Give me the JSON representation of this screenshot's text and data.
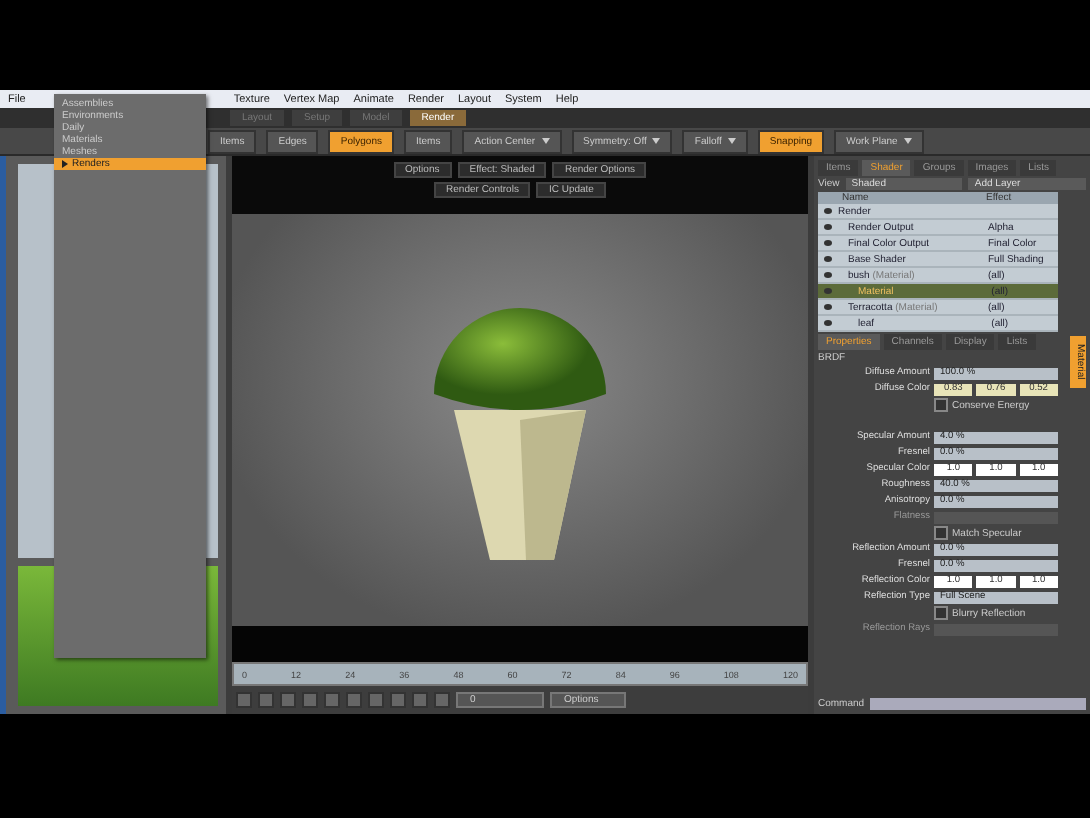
{
  "menu_bar": {
    "lead": [
      "File"
    ],
    "items": [
      "Texture",
      "Vertex Map",
      "Animate",
      "Render",
      "Layout",
      "System",
      "Help"
    ]
  },
  "dropdown": {
    "items": [
      {
        "label": "Assemblies",
        "selected": false
      },
      {
        "label": "Environments",
        "selected": false
      },
      {
        "label": "Daily",
        "selected": false
      },
      {
        "label": "Materials",
        "selected": false
      },
      {
        "label": "Meshes",
        "selected": false
      },
      {
        "label": "Renders",
        "selected": true
      }
    ]
  },
  "mode_tabs": [
    {
      "label": "Layout",
      "selected": false
    },
    {
      "label": "Setup",
      "selected": false
    },
    {
      "label": "Model",
      "selected": false
    },
    {
      "label": "Render",
      "selected": true
    }
  ],
  "toolbar": [
    {
      "kind": "button",
      "label": "Items",
      "selected": false
    },
    {
      "kind": "button",
      "label": "Edges",
      "selected": false
    },
    {
      "kind": "button",
      "label": "Polygons",
      "selected": true
    },
    {
      "kind": "button",
      "label": "Items",
      "selected": false
    },
    {
      "kind": "menu",
      "label": "Action Center",
      "selected": false
    },
    {
      "kind": "menu",
      "label": "Symmetry: Off",
      "selected": false
    },
    {
      "kind": "menu",
      "label": "Falloff",
      "selected": false
    },
    {
      "kind": "button",
      "label": "Snapping",
      "selected": true
    },
    {
      "kind": "menu",
      "label": "Work Plane",
      "selected": false
    }
  ],
  "viewport": {
    "tabs": [
      [
        "Options",
        "Effect: Shaded",
        "Render Options"
      ],
      [
        "Render Controls",
        "IC Update"
      ]
    ]
  },
  "timeline": {
    "ticks": [
      "0",
      "12",
      "24",
      "36",
      "48",
      "60",
      "72",
      "84",
      "96",
      "108",
      "120"
    ]
  },
  "playback": {
    "frame": "0",
    "options": "Options"
  },
  "shader_panel": {
    "tabs": [
      {
        "label": "Items",
        "selected": false
      },
      {
        "label": "Shader",
        "selected": true
      },
      {
        "label": "Groups",
        "selected": false
      },
      {
        "label": "Images",
        "selected": false
      },
      {
        "label": "Lists",
        "selected": false
      }
    ],
    "view_label": "View",
    "view": "Shaded",
    "add_layer": "Add Layer",
    "columns": [
      "Name",
      "Effect"
    ],
    "rows": [
      {
        "name": "Render",
        "selected": false,
        "children": [
          {
            "name": "Render Output",
            "effect": "Alpha",
            "selected": false
          },
          {
            "name": "Final Color Output",
            "effect": "Final Color",
            "selected": false
          },
          {
            "name": "Base Shader",
            "effect": "Full Shading",
            "selected": false
          },
          {
            "name": "bush",
            "suffix": "(Material)",
            "effect": "(all)",
            "selected": false,
            "children": [
              {
                "name": "Material",
                "effect": "(all)",
                "selected": true
              }
            ]
          },
          {
            "name": "Terracotta",
            "suffix": "(Material)",
            "effect": "(all)",
            "selected": false,
            "children": [
              {
                "name": "leaf",
                "effect": "(all)",
                "selected": false
              }
            ]
          }
        ]
      }
    ]
  },
  "properties": {
    "tabs": [
      {
        "label": "Properties",
        "selected": true
      },
      {
        "label": "Channels",
        "selected": false
      },
      {
        "label": "Display",
        "selected": false
      },
      {
        "label": "Lists",
        "selected": false
      }
    ],
    "section": "BRDF",
    "rows": [
      {
        "kind": "value",
        "label": "Diffuse Amount",
        "value": "100.0 %",
        "disabled": false
      },
      {
        "kind": "color",
        "label": "Diffuse Color",
        "values": [
          "0.83",
          "0.76",
          "0.52"
        ],
        "color": "#e8e4b8"
      },
      {
        "kind": "check",
        "label": "Conserve Energy",
        "checked": false
      },
      {
        "kind": "gap"
      },
      {
        "kind": "value",
        "label": "Specular Amount",
        "value": "4.0 %",
        "disabled": false
      },
      {
        "kind": "value",
        "label": "Fresnel",
        "value": "0.0 %",
        "disabled": false
      },
      {
        "kind": "color",
        "label": "Specular Color",
        "values": [
          "1.0",
          "1.0",
          "1.0"
        ],
        "color": "#ffffff"
      },
      {
        "kind": "value",
        "label": "Roughness",
        "value": "40.0 %",
        "disabled": false
      },
      {
        "kind": "value",
        "label": "Anisotropy",
        "value": "0.0 %",
        "disabled": false
      },
      {
        "kind": "value",
        "label": "Flatness",
        "value": "",
        "disabled": true
      },
      {
        "kind": "check",
        "label": "Match Specular",
        "checked": false
      },
      {
        "kind": "value",
        "label": "Reflection Amount",
        "value": "0.0 %",
        "disabled": false
      },
      {
        "kind": "value",
        "label": "Fresnel",
        "value": "0.0 %",
        "disabled": false
      },
      {
        "kind": "color",
        "label": "Reflection Color",
        "values": [
          "1.0",
          "1.0",
          "1.0"
        ],
        "color": "#ffffff"
      },
      {
        "kind": "value",
        "label": "Reflection Type",
        "value": "Full Scene",
        "disabled": false
      },
      {
        "kind": "check",
        "label": "Blurry Reflection",
        "checked": false
      },
      {
        "kind": "value",
        "label": "Reflection Rays",
        "value": "",
        "disabled": true
      }
    ]
  },
  "side_tab": {
    "label": "Material"
  },
  "command": {
    "label": "Command"
  }
}
